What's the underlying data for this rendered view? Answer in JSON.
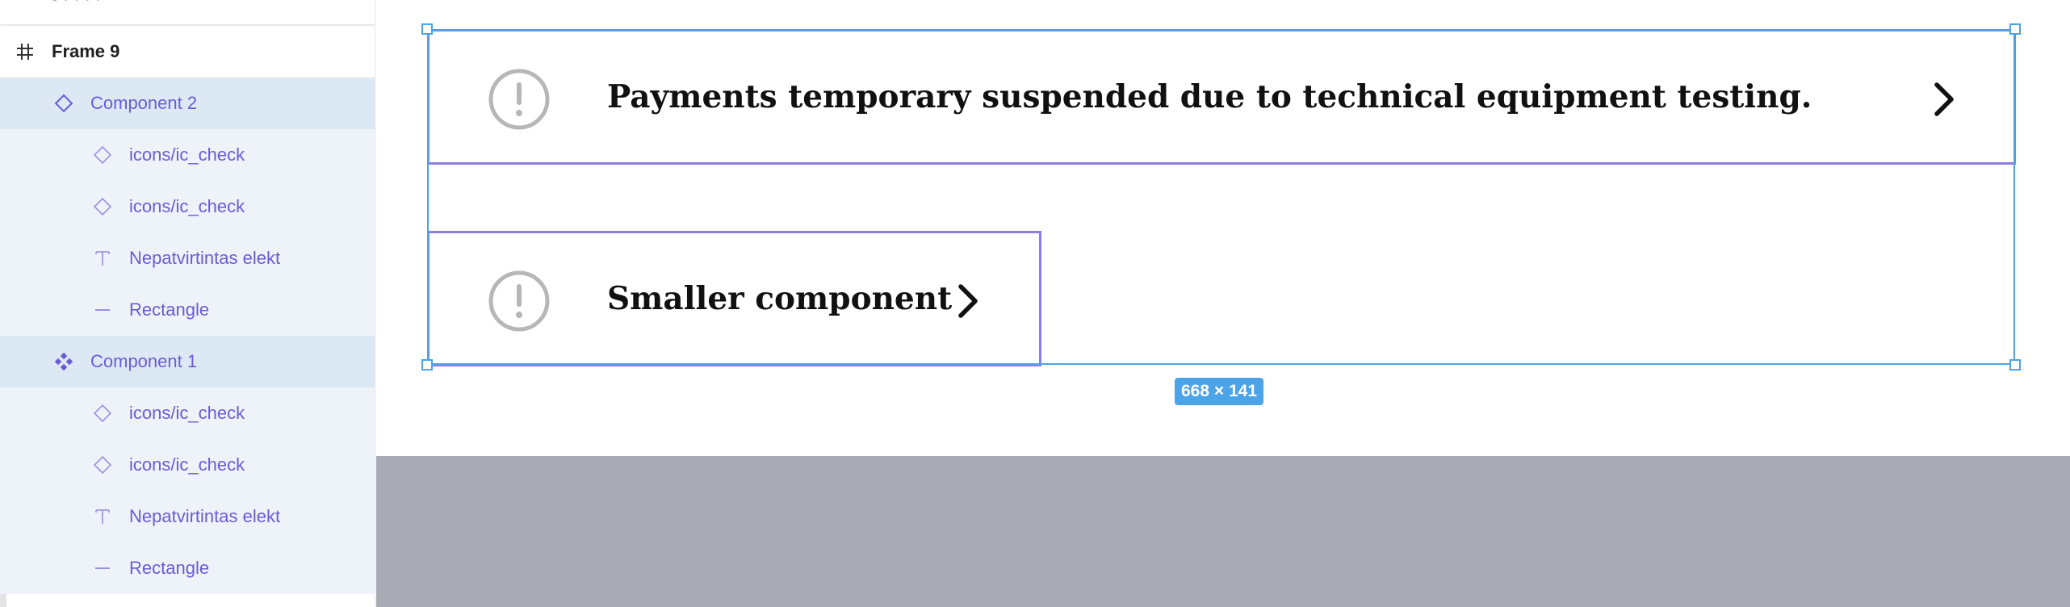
{
  "layers_panel": {
    "cut_off_label": "• · · · ·",
    "rows": [
      {
        "label": "Frame 9",
        "icon": "frame-hash-icon",
        "kind": "frame"
      },
      {
        "label": "Component 2",
        "icon": "component-instance-icon",
        "kind": "component"
      },
      {
        "label": "icons/ic_check",
        "icon": "component-instance-icon",
        "kind": "child"
      },
      {
        "label": "icons/ic_check",
        "icon": "component-instance-icon",
        "kind": "child"
      },
      {
        "label": "Nepatvirtintas elekt",
        "icon": "text-layer-icon",
        "kind": "child"
      },
      {
        "label": "Rectangle",
        "icon": "rectangle-layer-icon",
        "kind": "child"
      },
      {
        "label": "Component 1",
        "icon": "main-component-icon",
        "kind": "component"
      },
      {
        "label": "icons/ic_check",
        "icon": "component-instance-icon",
        "kind": "child"
      },
      {
        "label": "icons/ic_check",
        "icon": "component-instance-icon",
        "kind": "child"
      },
      {
        "label": "Nepatvirtintas elekt",
        "icon": "text-layer-icon",
        "kind": "child"
      },
      {
        "label": "Rectangle",
        "icon": "rectangle-layer-icon",
        "kind": "child"
      }
    ]
  },
  "canvas": {
    "large_component": {
      "text": "Payments temporary suspended due to technical equipment testing.",
      "icon": "alert-circle-icon",
      "trailing_icon": "chevron-right-icon"
    },
    "small_component": {
      "text": "Smaller component",
      "icon": "alert-circle-icon",
      "trailing_icon": "chevron-right-icon"
    },
    "selection_size_label": "668 × 141"
  },
  "colors": {
    "selection": "#4ba3e8",
    "component_border": "#8b7fe0",
    "layer_text": "#6b5bd6",
    "canvas_gray": "#a8abb3"
  }
}
